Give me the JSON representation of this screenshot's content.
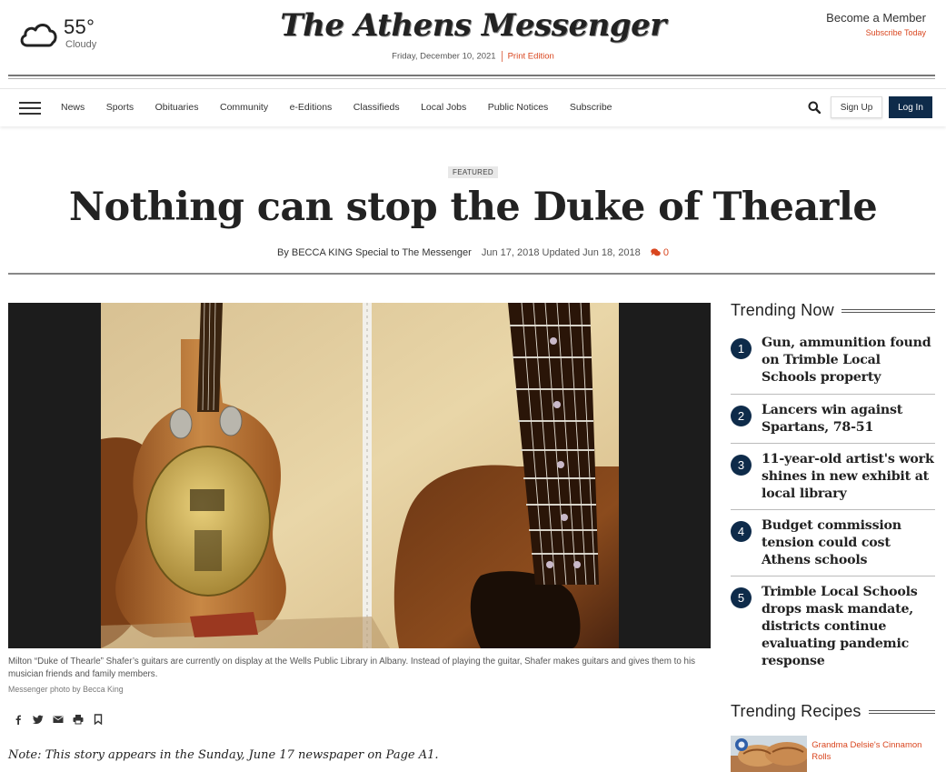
{
  "weather": {
    "temperature": "55°",
    "condition": "Cloudy",
    "icon": "cloud-icon"
  },
  "brand": {
    "logo_text": "The Athens Messenger",
    "date": "Friday, December 10, 2021",
    "print_edition": "Print Edition"
  },
  "member": {
    "become": "Become a Member",
    "subscribe": "Subscribe Today"
  },
  "nav": {
    "items": [
      "News",
      "Sports",
      "Obituaries",
      "Community",
      "e-Editions",
      "Classifieds",
      "Local Jobs",
      "Public Notices",
      "Subscribe"
    ],
    "sign_up": "Sign Up",
    "log_in": "Log In"
  },
  "article": {
    "badge": "FEATURED",
    "headline": "Nothing can stop the Duke of Thearle",
    "byline": "By BECCA KING Special to The Messenger",
    "dates": "Jun 17, 2018 Updated Jun 18, 2018",
    "comments": "0",
    "caption": "Milton “Duke of Thearle” Shafer’s guitars are currently on display at the Wells Public Library in Albany. Instead of playing the guitar, Shafer makes guitars and gives them to his musician friends and family members.",
    "credit": "Messenger photo by Becca King",
    "note": "Note: This story appears in the Sunday, June 17 newspaper on Page A1."
  },
  "sidebar": {
    "trending_title": "Trending Now",
    "trending": [
      {
        "num": "1",
        "title": "Gun, ammunition found on Trimble Local Schools property"
      },
      {
        "num": "2",
        "title": "Lancers win against Spartans, 78-51"
      },
      {
        "num": "3",
        "title": "11-year-old artist's work shines in new exhibit at local library"
      },
      {
        "num": "4",
        "title": "Budget commission tension could cost Athens schools"
      },
      {
        "num": "5",
        "title": "Trimble Local Schools drops mask mandate, districts continue evaluating pandemic response"
      }
    ],
    "recipes_title": "Trending Recipes",
    "recipe": {
      "title": "Grandma Delsie's Cinnamon Rolls"
    }
  },
  "colors": {
    "accent": "#d9461f",
    "navy": "#0e2b4a"
  }
}
